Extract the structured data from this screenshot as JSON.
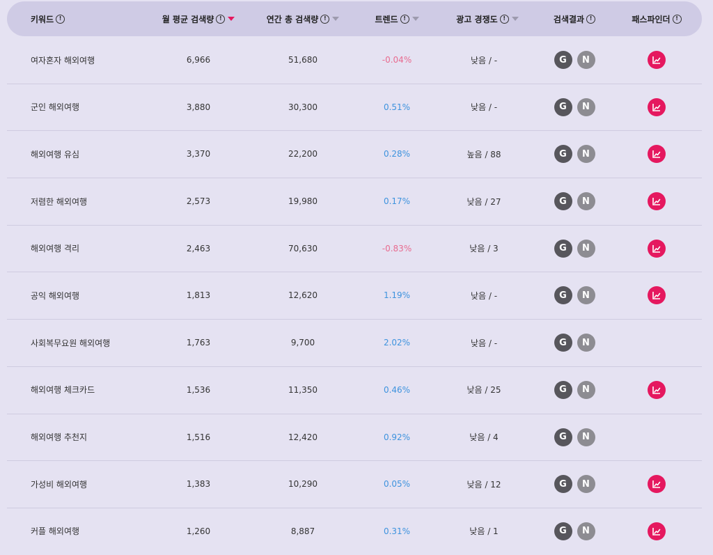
{
  "header": {
    "keyword": "키워드",
    "monthly": "월 평균 검색량",
    "yearly": "연간 총 검색량",
    "trend": "트렌드",
    "competition": "광고 경쟁도",
    "results": "검색결과",
    "pathfinder": "패스파인더",
    "info_glyph": "!"
  },
  "badges": {
    "google": "G",
    "naver": "N"
  },
  "colors": {
    "accent": "#e5185f",
    "trend_negative": "#e86b8f",
    "trend_positive": "#3e93de",
    "header_bg": "#cfcbe5",
    "page_bg": "#e5e2f2"
  },
  "icons": {
    "info": "info-circle-icon",
    "sort": "sort-down-icon",
    "pathfinder": "line-chart-icon"
  },
  "rows": [
    {
      "keyword": "여자혼자 해외여행",
      "monthly": "6,966",
      "yearly": "51,680",
      "trend": "-0.04%",
      "trend_dir": "neg",
      "competition": "낮음 / -",
      "pathfinder": true
    },
    {
      "keyword": "군인 해외여행",
      "monthly": "3,880",
      "yearly": "30,300",
      "trend": "0.51%",
      "trend_dir": "pos",
      "competition": "낮음 / -",
      "pathfinder": true
    },
    {
      "keyword": "해외여행 유심",
      "monthly": "3,370",
      "yearly": "22,200",
      "trend": "0.28%",
      "trend_dir": "pos",
      "competition": "높음 / 88",
      "pathfinder": true
    },
    {
      "keyword": "저렴한 해외여행",
      "monthly": "2,573",
      "yearly": "19,980",
      "trend": "0.17%",
      "trend_dir": "pos",
      "competition": "낮음 / 27",
      "pathfinder": true
    },
    {
      "keyword": "해외여행 격리",
      "monthly": "2,463",
      "yearly": "70,630",
      "trend": "-0.83%",
      "trend_dir": "neg",
      "competition": "낮음 / 3",
      "pathfinder": true
    },
    {
      "keyword": "공익 해외여행",
      "monthly": "1,813",
      "yearly": "12,620",
      "trend": "1.19%",
      "trend_dir": "pos",
      "competition": "낮음 / -",
      "pathfinder": true
    },
    {
      "keyword": "사회복무요원 해외여행",
      "monthly": "1,763",
      "yearly": "9,700",
      "trend": "2.02%",
      "trend_dir": "pos",
      "competition": "낮음 / -",
      "pathfinder": false
    },
    {
      "keyword": "해외여행 체크카드",
      "monthly": "1,536",
      "yearly": "11,350",
      "trend": "0.46%",
      "trend_dir": "pos",
      "competition": "낮음 / 25",
      "pathfinder": true
    },
    {
      "keyword": "해외여행 추천지",
      "monthly": "1,516",
      "yearly": "12,420",
      "trend": "0.92%",
      "trend_dir": "pos",
      "competition": "낮음 / 4",
      "pathfinder": false
    },
    {
      "keyword": "가성비 해외여행",
      "monthly": "1,383",
      "yearly": "10,290",
      "trend": "0.05%",
      "trend_dir": "pos",
      "competition": "낮음 / 12",
      "pathfinder": true
    },
    {
      "keyword": "커플 해외여행",
      "monthly": "1,260",
      "yearly": "8,887",
      "trend": "0.31%",
      "trend_dir": "pos",
      "competition": "낮음 / 1",
      "pathfinder": true
    }
  ]
}
